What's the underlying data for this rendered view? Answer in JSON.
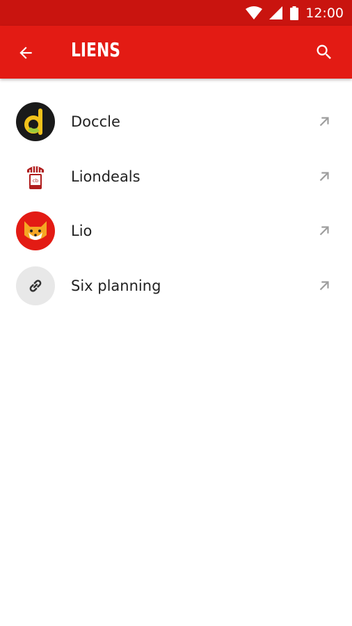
{
  "status_bar": {
    "time": "12:00"
  },
  "app_bar": {
    "title": "LIENS"
  },
  "links": [
    {
      "label": "Doccle",
      "icon": "doccle-logo-icon"
    },
    {
      "label": "Liondeals",
      "icon": "liondeals-logo-icon"
    },
    {
      "label": "Lio",
      "icon": "lio-fox-logo-icon"
    },
    {
      "label": "Six planning",
      "icon": "link-icon"
    }
  ],
  "colors": {
    "status_bar": "#c9140f",
    "app_bar": "#e31b14",
    "text": "#222222",
    "arrow": "#9e9e9e"
  }
}
